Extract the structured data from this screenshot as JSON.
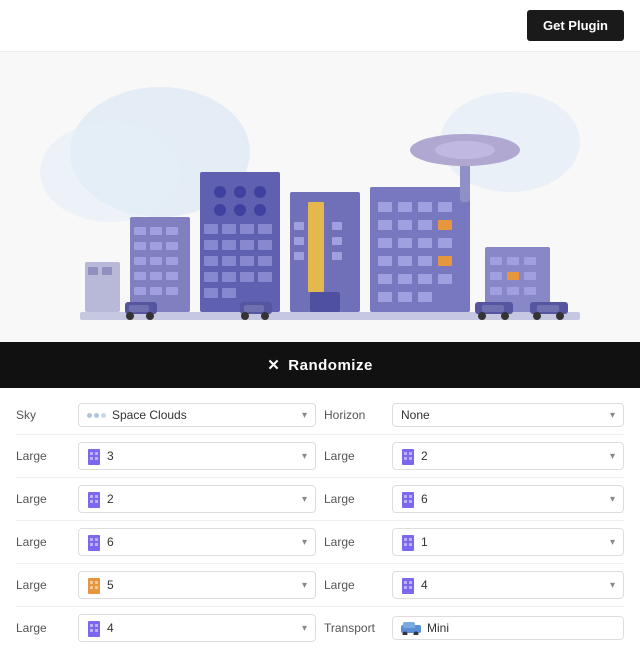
{
  "header": {
    "plugin_btn": "Get Plugin"
  },
  "randomize": {
    "label": "Randomize",
    "icon": "✕"
  },
  "rows": [
    {
      "left_label": "Sky",
      "left_icon": "sky",
      "left_value": "Space Clouds",
      "right_label": "Horizon",
      "right_icon": null,
      "right_value": "None"
    },
    {
      "left_label": "Large",
      "left_icon": "building_purple",
      "left_value": "3",
      "right_label": "Large",
      "right_icon": "building_purple",
      "right_value": "2"
    },
    {
      "left_label": "Large",
      "left_icon": "building_purple",
      "left_value": "2",
      "right_label": "Large",
      "right_icon": "building_purple",
      "right_value": "6"
    },
    {
      "left_label": "Large",
      "left_icon": "building_purple",
      "left_value": "6",
      "right_label": "Large",
      "right_icon": "building_purple",
      "right_value": "1"
    },
    {
      "left_label": "Large",
      "left_icon": "building_orange",
      "left_value": "5",
      "right_label": "Large",
      "right_icon": "building_purple",
      "right_value": "4"
    },
    {
      "left_label": "Large",
      "left_icon": "building_purple",
      "left_value": "4",
      "right_label": "Transport",
      "right_icon": "car",
      "right_value": "Mini"
    }
  ],
  "colors": {
    "building_purple": "#7b68ee",
    "building_orange": "#e8963e",
    "sky_cloud": "#b0c4de",
    "car": "#5b8dd9"
  }
}
